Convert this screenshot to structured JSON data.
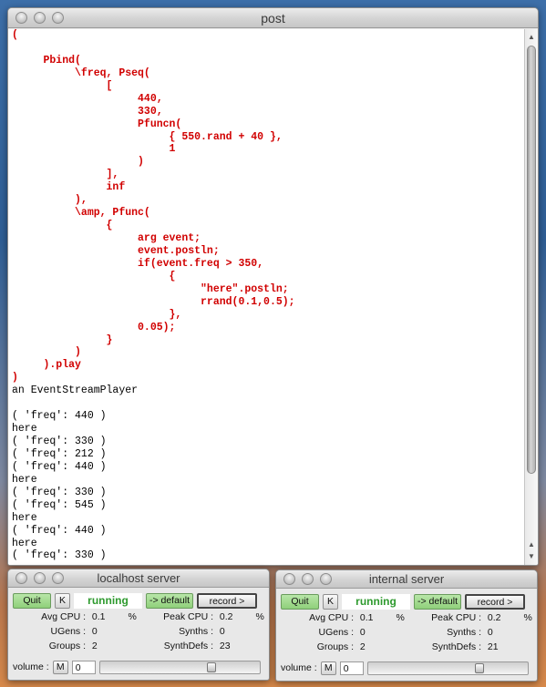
{
  "post_window": {
    "title": "post",
    "lines": [
      {
        "text": "(",
        "style": "red"
      },
      {
        "text": "",
        "style": "red"
      },
      {
        "text": "     Pbind(",
        "style": "red"
      },
      {
        "text": "          \\freq, Pseq(",
        "style": "red"
      },
      {
        "text": "               [",
        "style": "red"
      },
      {
        "text": "                    440,",
        "style": "red"
      },
      {
        "text": "                    330,",
        "style": "red"
      },
      {
        "text": "                    Pfuncn(",
        "style": "red"
      },
      {
        "text": "                         { 550.rand + 40 },",
        "style": "red"
      },
      {
        "text": "                         1",
        "style": "red"
      },
      {
        "text": "                    )",
        "style": "red"
      },
      {
        "text": "               ],",
        "style": "red"
      },
      {
        "text": "               inf",
        "style": "red"
      },
      {
        "text": "          ),",
        "style": "red"
      },
      {
        "text": "          \\amp, Pfunc(",
        "style": "red"
      },
      {
        "text": "               {",
        "style": "red"
      },
      {
        "text": "                    arg event;",
        "style": "red"
      },
      {
        "text": "                    event.postln;",
        "style": "red"
      },
      {
        "text": "                    if(event.freq > 350,",
        "style": "red"
      },
      {
        "text": "                         {",
        "style": "red"
      },
      {
        "text": "                              \"here\".postln;",
        "style": "red"
      },
      {
        "text": "                              rrand(0.1,0.5);",
        "style": "red"
      },
      {
        "text": "                         },",
        "style": "red"
      },
      {
        "text": "                    0.05);",
        "style": "red"
      },
      {
        "text": "               }",
        "style": "red"
      },
      {
        "text": "          )",
        "style": "red"
      },
      {
        "text": "     ).play",
        "style": "red"
      },
      {
        "text": ")",
        "style": "red"
      },
      {
        "text": "an EventStreamPlayer",
        "style": "black"
      },
      {
        "text": "",
        "style": "black"
      },
      {
        "text": "( 'freq': 440 )",
        "style": "black"
      },
      {
        "text": "here",
        "style": "black"
      },
      {
        "text": "( 'freq': 330 )",
        "style": "black"
      },
      {
        "text": "( 'freq': 212 )",
        "style": "black"
      },
      {
        "text": "( 'freq': 440 )",
        "style": "black"
      },
      {
        "text": "here",
        "style": "black"
      },
      {
        "text": "( 'freq': 330 )",
        "style": "black"
      },
      {
        "text": "( 'freq': 545 )",
        "style": "black"
      },
      {
        "text": "here",
        "style": "black"
      },
      {
        "text": "( 'freq': 440 )",
        "style": "black"
      },
      {
        "text": "here",
        "style": "black"
      },
      {
        "text": "( 'freq': 330 )",
        "style": "black"
      }
    ],
    "scroll_up_icon": "triangle-up",
    "scroll_down_icon": "triangle-down"
  },
  "servers": [
    {
      "title": "localhost server",
      "quit_label": "Quit",
      "k_label": "K",
      "status": "running",
      "default_label": "-> default",
      "record_label": "record >",
      "avg_cpu_label": "Avg CPU :",
      "avg_cpu": "0.1",
      "pct": "%",
      "peak_cpu_label": "Peak CPU :",
      "peak_cpu": "0.2",
      "ugens_label": "UGens :",
      "ugens": "0",
      "synths_label": "Synths :",
      "synths": "0",
      "groups_label": "Groups :",
      "groups": "2",
      "synthdefs_label": "SynthDefs :",
      "synthdefs": "23",
      "volume_label": "volume :",
      "m_label": "M",
      "volume_value": "0",
      "volume_level": 0.72
    },
    {
      "title": "internal server",
      "quit_label": "Quit",
      "k_label": "K",
      "status": "running",
      "default_label": "-> default",
      "record_label": "record >",
      "avg_cpu_label": "Avg CPU :",
      "avg_cpu": "0.1",
      "pct": "%",
      "peak_cpu_label": "Peak CPU :",
      "peak_cpu": "0.2",
      "ugens_label": "UGens :",
      "ugens": "0",
      "synths_label": "Synths :",
      "synths": "0",
      "groups_label": "Groups :",
      "groups": "2",
      "synthdefs_label": "SynthDefs :",
      "synthdefs": "21",
      "volume_label": "volume :",
      "m_label": "M",
      "volume_value": "0",
      "volume_level": 0.72
    }
  ],
  "colors": {
    "code_red": "#d10000",
    "running_green": "#2e9a2e",
    "button_green": "#9fd88c"
  }
}
